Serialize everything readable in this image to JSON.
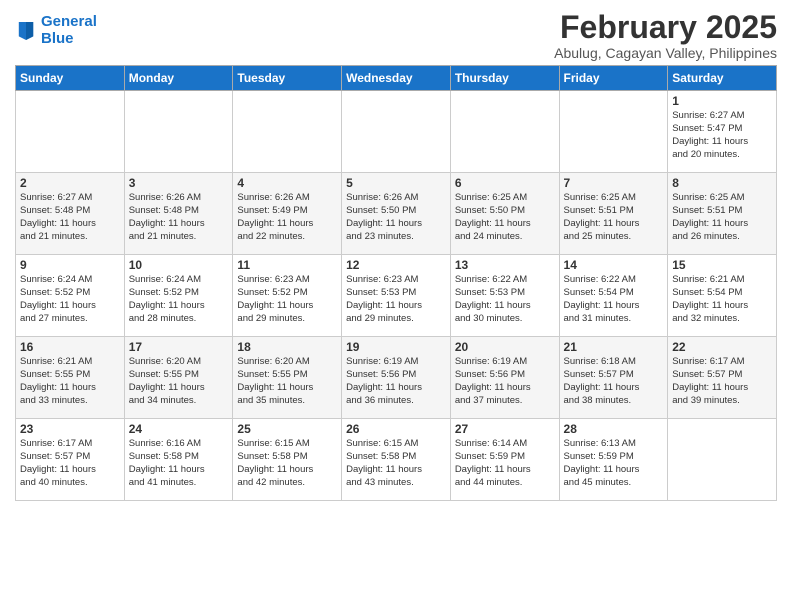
{
  "header": {
    "logo_line1": "General",
    "logo_line2": "Blue",
    "month_title": "February 2025",
    "location": "Abulug, Cagayan Valley, Philippines"
  },
  "days_of_week": [
    "Sunday",
    "Monday",
    "Tuesday",
    "Wednesday",
    "Thursday",
    "Friday",
    "Saturday"
  ],
  "weeks": [
    [
      {
        "day": "",
        "info": ""
      },
      {
        "day": "",
        "info": ""
      },
      {
        "day": "",
        "info": ""
      },
      {
        "day": "",
        "info": ""
      },
      {
        "day": "",
        "info": ""
      },
      {
        "day": "",
        "info": ""
      },
      {
        "day": "1",
        "info": "Sunrise: 6:27 AM\nSunset: 5:47 PM\nDaylight: 11 hours\nand 20 minutes."
      }
    ],
    [
      {
        "day": "2",
        "info": "Sunrise: 6:27 AM\nSunset: 5:48 PM\nDaylight: 11 hours\nand 21 minutes."
      },
      {
        "day": "3",
        "info": "Sunrise: 6:26 AM\nSunset: 5:48 PM\nDaylight: 11 hours\nand 21 minutes."
      },
      {
        "day": "4",
        "info": "Sunrise: 6:26 AM\nSunset: 5:49 PM\nDaylight: 11 hours\nand 22 minutes."
      },
      {
        "day": "5",
        "info": "Sunrise: 6:26 AM\nSunset: 5:50 PM\nDaylight: 11 hours\nand 23 minutes."
      },
      {
        "day": "6",
        "info": "Sunrise: 6:25 AM\nSunset: 5:50 PM\nDaylight: 11 hours\nand 24 minutes."
      },
      {
        "day": "7",
        "info": "Sunrise: 6:25 AM\nSunset: 5:51 PM\nDaylight: 11 hours\nand 25 minutes."
      },
      {
        "day": "8",
        "info": "Sunrise: 6:25 AM\nSunset: 5:51 PM\nDaylight: 11 hours\nand 26 minutes."
      }
    ],
    [
      {
        "day": "9",
        "info": "Sunrise: 6:24 AM\nSunset: 5:52 PM\nDaylight: 11 hours\nand 27 minutes."
      },
      {
        "day": "10",
        "info": "Sunrise: 6:24 AM\nSunset: 5:52 PM\nDaylight: 11 hours\nand 28 minutes."
      },
      {
        "day": "11",
        "info": "Sunrise: 6:23 AM\nSunset: 5:52 PM\nDaylight: 11 hours\nand 29 minutes."
      },
      {
        "day": "12",
        "info": "Sunrise: 6:23 AM\nSunset: 5:53 PM\nDaylight: 11 hours\nand 29 minutes."
      },
      {
        "day": "13",
        "info": "Sunrise: 6:22 AM\nSunset: 5:53 PM\nDaylight: 11 hours\nand 30 minutes."
      },
      {
        "day": "14",
        "info": "Sunrise: 6:22 AM\nSunset: 5:54 PM\nDaylight: 11 hours\nand 31 minutes."
      },
      {
        "day": "15",
        "info": "Sunrise: 6:21 AM\nSunset: 5:54 PM\nDaylight: 11 hours\nand 32 minutes."
      }
    ],
    [
      {
        "day": "16",
        "info": "Sunrise: 6:21 AM\nSunset: 5:55 PM\nDaylight: 11 hours\nand 33 minutes."
      },
      {
        "day": "17",
        "info": "Sunrise: 6:20 AM\nSunset: 5:55 PM\nDaylight: 11 hours\nand 34 minutes."
      },
      {
        "day": "18",
        "info": "Sunrise: 6:20 AM\nSunset: 5:55 PM\nDaylight: 11 hours\nand 35 minutes."
      },
      {
        "day": "19",
        "info": "Sunrise: 6:19 AM\nSunset: 5:56 PM\nDaylight: 11 hours\nand 36 minutes."
      },
      {
        "day": "20",
        "info": "Sunrise: 6:19 AM\nSunset: 5:56 PM\nDaylight: 11 hours\nand 37 minutes."
      },
      {
        "day": "21",
        "info": "Sunrise: 6:18 AM\nSunset: 5:57 PM\nDaylight: 11 hours\nand 38 minutes."
      },
      {
        "day": "22",
        "info": "Sunrise: 6:17 AM\nSunset: 5:57 PM\nDaylight: 11 hours\nand 39 minutes."
      }
    ],
    [
      {
        "day": "23",
        "info": "Sunrise: 6:17 AM\nSunset: 5:57 PM\nDaylight: 11 hours\nand 40 minutes."
      },
      {
        "day": "24",
        "info": "Sunrise: 6:16 AM\nSunset: 5:58 PM\nDaylight: 11 hours\nand 41 minutes."
      },
      {
        "day": "25",
        "info": "Sunrise: 6:15 AM\nSunset: 5:58 PM\nDaylight: 11 hours\nand 42 minutes."
      },
      {
        "day": "26",
        "info": "Sunrise: 6:15 AM\nSunset: 5:58 PM\nDaylight: 11 hours\nand 43 minutes."
      },
      {
        "day": "27",
        "info": "Sunrise: 6:14 AM\nSunset: 5:59 PM\nDaylight: 11 hours\nand 44 minutes."
      },
      {
        "day": "28",
        "info": "Sunrise: 6:13 AM\nSunset: 5:59 PM\nDaylight: 11 hours\nand 45 minutes."
      },
      {
        "day": "",
        "info": ""
      }
    ]
  ]
}
